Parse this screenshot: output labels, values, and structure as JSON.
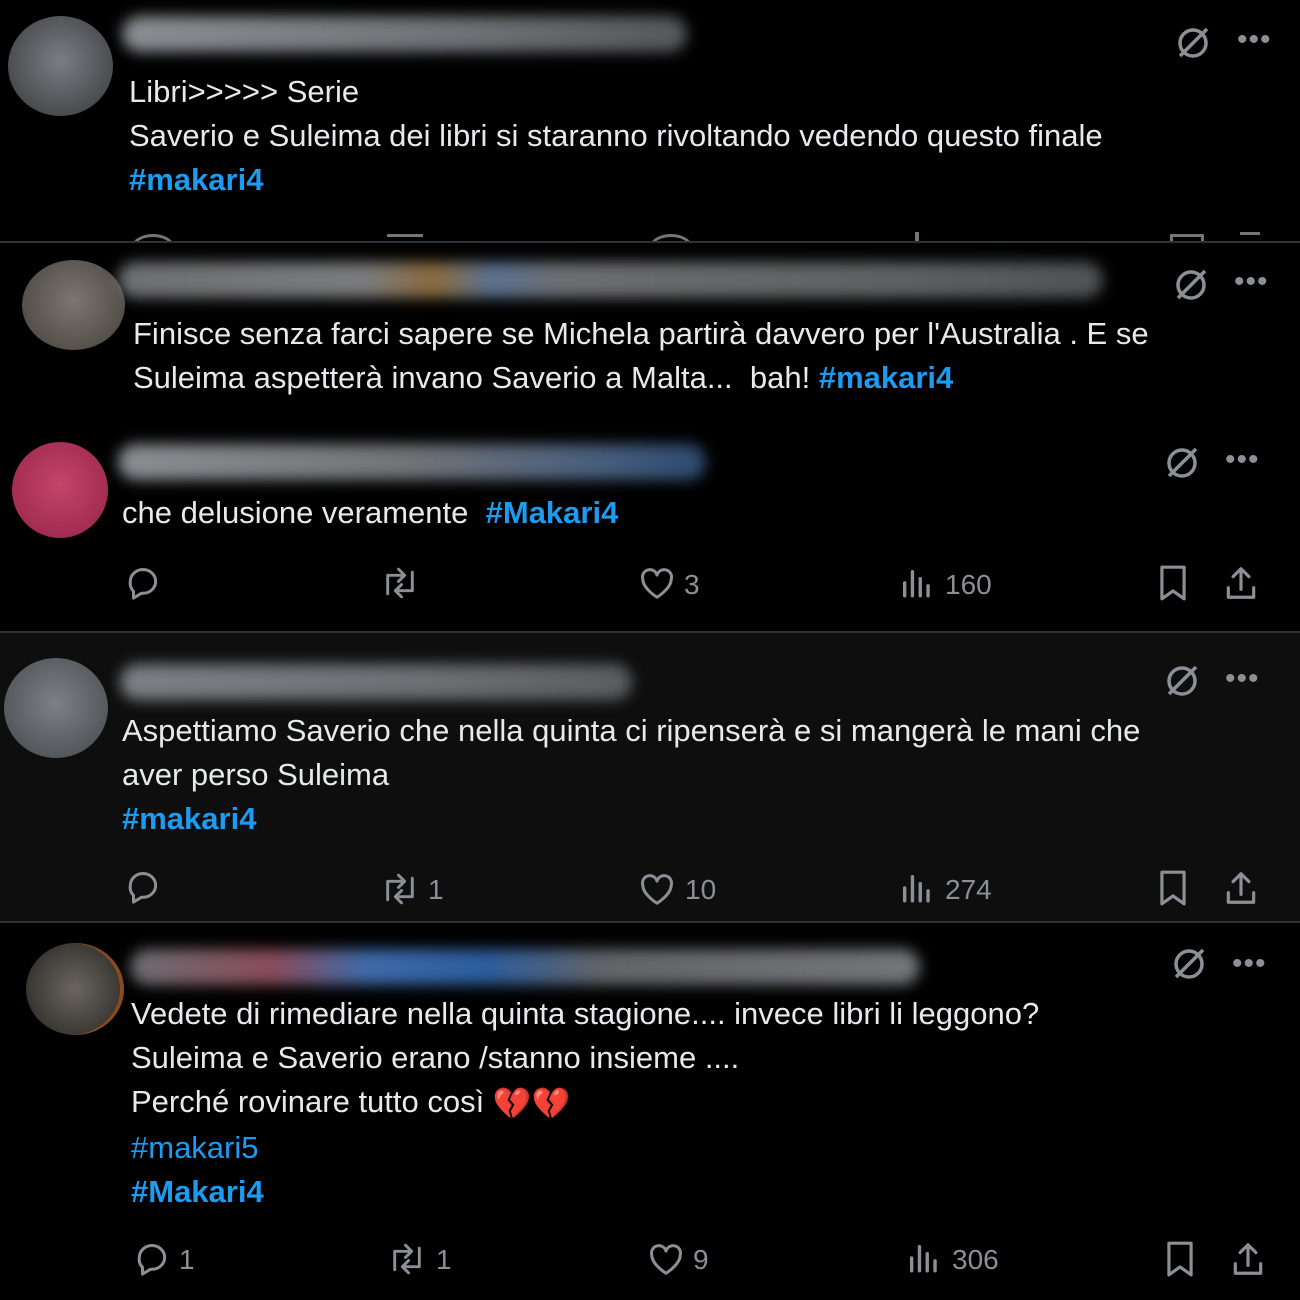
{
  "posts": [
    {
      "lines": [
        [
          {
            "t": "Libri>>>>> Serie",
            "tag": false
          }
        ],
        [
          {
            "t": "Saverio e Suleima dei libri si staranno rivoltando vedendo questo finale",
            "tag": false
          }
        ],
        [
          {
            "t": "#makari4",
            "tag": true
          }
        ]
      ]
    },
    {
      "lines": [
        [
          {
            "t": "Finisce senza farci sapere se Michela partirà davvero per l'Australia . E se",
            "tag": false
          }
        ],
        [
          {
            "t": "Suleima aspetterà invano Saverio a Malta...  bah! ",
            "tag": false
          },
          {
            "t": "#makari4",
            "tag": true
          }
        ]
      ]
    },
    {
      "lines": [
        [
          {
            "t": "che delusione veramente  ",
            "tag": false
          },
          {
            "t": "#Makari4",
            "tag": true
          }
        ]
      ],
      "stats": {
        "replies": "",
        "reposts": "",
        "likes": "3",
        "views": "160"
      }
    },
    {
      "lines": [
        [
          {
            "t": "Aspettiamo Saverio che nella quinta ci ripenserà e si mangerà le mani che",
            "tag": false
          }
        ],
        [
          {
            "t": "aver perso Suleima",
            "tag": false
          }
        ],
        [
          {
            "t": "#makari4",
            "tag": true
          }
        ]
      ],
      "stats": {
        "replies": "",
        "reposts": "1",
        "likes": "10",
        "views": "274"
      }
    },
    {
      "lines": [
        [
          {
            "t": "Vedete di rimediare nella quinta stagione.... invece libri li leggono?",
            "tag": false
          }
        ],
        [
          {
            "t": "Suleima e Saverio erano /stanno insieme ....",
            "tag": false
          }
        ],
        [
          {
            "t": "Perché rovinare tutto così ",
            "tag": false
          },
          {
            "t": "💔💔",
            "emoji": true
          }
        ],
        [
          {
            "t": "#makari5",
            "tag": true,
            "light": true
          }
        ],
        [
          {
            "t": "#Makari4",
            "tag": true
          }
        ]
      ],
      "stats": {
        "replies": "1",
        "reposts": "1",
        "likes": "9",
        "views": "306"
      }
    }
  ],
  "colors": {
    "accent": "#1d9bf0",
    "muted": "#71767b",
    "text": "#e7e9ea",
    "bg": "#000000"
  },
  "icons": [
    "grok-icon",
    "more-icon",
    "reply-icon",
    "repost-icon",
    "like-icon",
    "views-icon",
    "bookmark-icon",
    "share-icon"
  ]
}
